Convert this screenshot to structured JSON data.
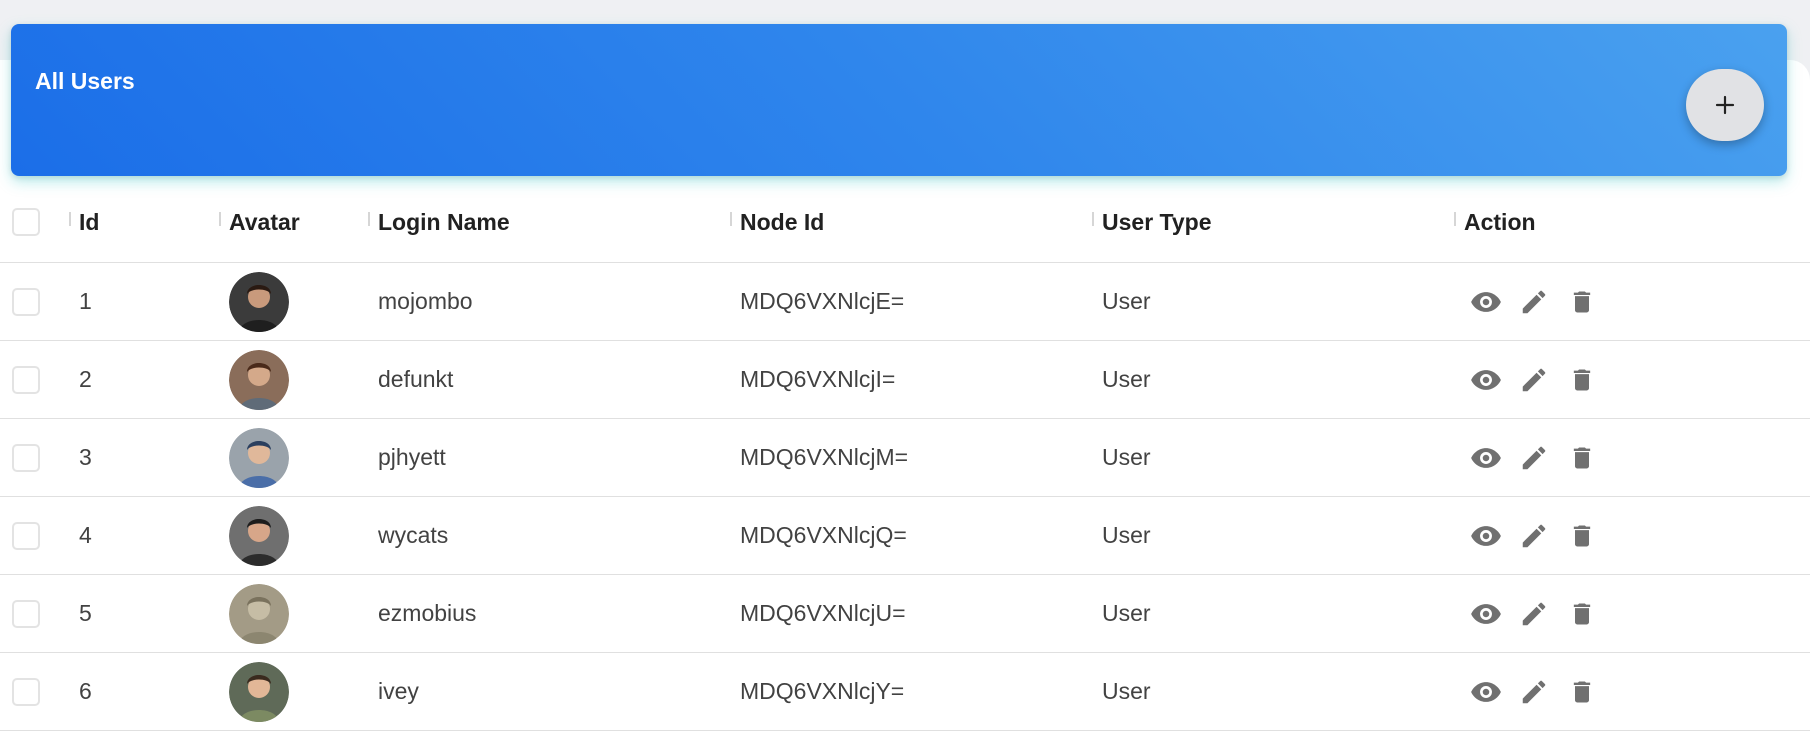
{
  "header": {
    "title": "All Users",
    "add_button_icon": "plus-icon"
  },
  "columns": [
    "Id",
    "Avatar",
    "Login Name",
    "Node Id",
    "User Type",
    "Action"
  ],
  "rows": [
    {
      "id": "1",
      "login": "mojombo",
      "node_id": "MDQ6VXNlcjE=",
      "type": "User"
    },
    {
      "id": "2",
      "login": "defunkt",
      "node_id": "MDQ6VXNlcjI=",
      "type": "User"
    },
    {
      "id": "3",
      "login": "pjhyett",
      "node_id": "MDQ6VXNlcjM=",
      "type": "User"
    },
    {
      "id": "4",
      "login": "wycats",
      "node_id": "MDQ6VXNlcjQ=",
      "type": "User"
    },
    {
      "id": "5",
      "login": "ezmobius",
      "node_id": "MDQ6VXNlcjU=",
      "type": "User"
    },
    {
      "id": "6",
      "login": "ivey",
      "node_id": "MDQ6VXNlcjY=",
      "type": "User"
    }
  ],
  "row_actions": [
    "eye-icon",
    "pencil-icon",
    "trash-icon"
  ],
  "colors": {
    "header_start": "#1b6ee8",
    "header_end": "#4aa1ef",
    "action_icon": "#707070"
  }
}
